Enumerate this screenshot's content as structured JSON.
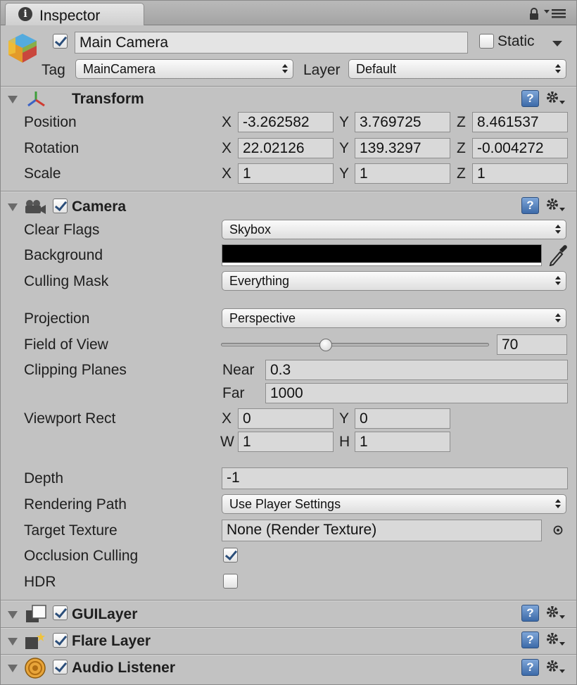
{
  "tab": {
    "title": "Inspector"
  },
  "header": {
    "object_name": "Main Camera",
    "static_label": "Static",
    "tag_label": "Tag",
    "tag_value": "MainCamera",
    "layer_label": "Layer",
    "layer_value": "Default"
  },
  "transform": {
    "title": "Transform",
    "rows": [
      {
        "label": "Position",
        "x": "-3.262582",
        "y": "3.769725",
        "z": "8.461537"
      },
      {
        "label": "Rotation",
        "x": "22.02126",
        "y": "139.3297",
        "z": "-0.004272"
      },
      {
        "label": "Scale",
        "x": "1",
        "y": "1",
        "z": "1"
      }
    ],
    "axis": {
      "x": "X",
      "y": "Y",
      "z": "Z"
    }
  },
  "camera": {
    "title": "Camera",
    "clear_flags": {
      "label": "Clear Flags",
      "value": "Skybox"
    },
    "background": {
      "label": "Background",
      "color": "#000000"
    },
    "culling_mask": {
      "label": "Culling Mask",
      "value": "Everything"
    },
    "projection": {
      "label": "Projection",
      "value": "Perspective"
    },
    "field_of_view": {
      "label": "Field of View",
      "value": "70",
      "fraction": 0.39
    },
    "clipping_planes": {
      "label": "Clipping Planes",
      "near_label": "Near",
      "near": "0.3",
      "far_label": "Far",
      "far": "1000"
    },
    "viewport_rect": {
      "label": "Viewport Rect",
      "x_label": "X",
      "x": "0",
      "y_label": "Y",
      "y": "0",
      "w_label": "W",
      "w": "1",
      "h_label": "H",
      "h": "1"
    },
    "depth": {
      "label": "Depth",
      "value": "-1"
    },
    "rendering_path": {
      "label": "Rendering Path",
      "value": "Use Player Settings"
    },
    "target_texture": {
      "label": "Target Texture",
      "value": "None (Render Texture)"
    },
    "occlusion_culling": {
      "label": "Occlusion Culling",
      "checked": true
    },
    "hdr": {
      "label": "HDR",
      "checked": false
    }
  },
  "components": [
    {
      "title": "GUILayer"
    },
    {
      "title": "Flare Layer"
    },
    {
      "title": "Audio Listener"
    }
  ],
  "icons": {
    "help": "?",
    "info": "i"
  },
  "colors": {
    "panel_bg": "#c2c2c2",
    "help_blue": "#3c6aa8",
    "check_blue": "#2b4e7a"
  }
}
